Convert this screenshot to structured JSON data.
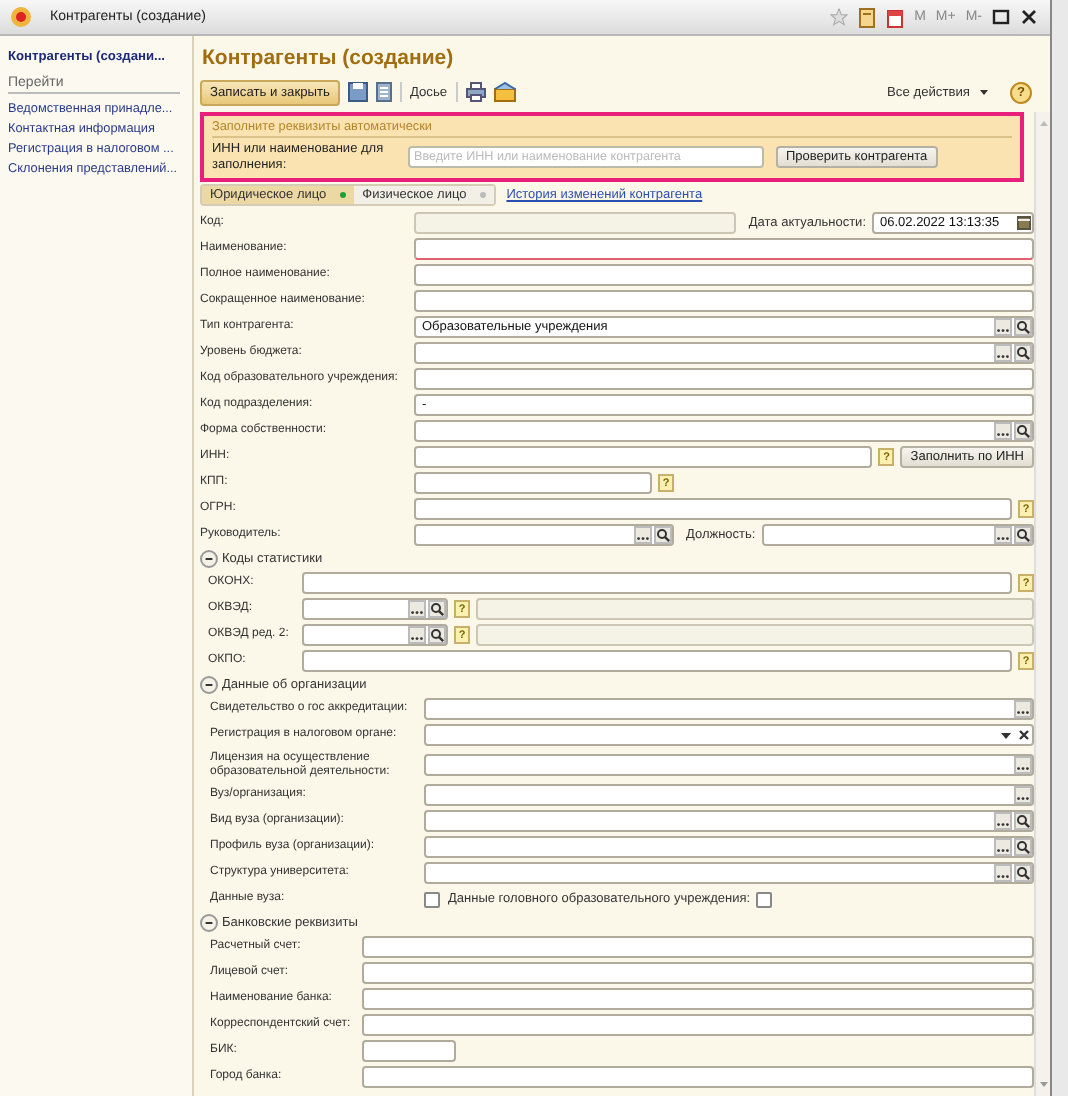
{
  "window": {
    "title": "Контрагенты (создание)",
    "memory_buttons": [
      "M",
      "M+",
      "M-"
    ]
  },
  "sidebar": {
    "title": "Контрагенты (создани...",
    "section": "Перейти",
    "items": [
      "Ведомственная принадле...",
      "Контактная информация",
      "Регистрация в налоговом ...",
      "Склонения представлений..."
    ]
  },
  "form": {
    "title": "Контрагенты (создание)",
    "save_close": "Записать и закрыть",
    "dossier": "Досье",
    "all_actions": "Все действия",
    "help": "?"
  },
  "autofill": {
    "heading": "Заполните реквизиты автоматически",
    "label": "ИНН или наименование для заполнения:",
    "placeholder": "Введите ИНН или наименование контрагента",
    "button": "Проверить контрагента"
  },
  "person_tabs": [
    {
      "label": "Юридическое лицо",
      "selected": true
    },
    {
      "label": "Физическое лицо",
      "selected": false
    }
  ],
  "history_link": "История изменений контрагента",
  "main_fields": [
    {
      "kind": "code_date",
      "label": "Код:",
      "date_label": "Дата актуальности:",
      "date_value": "06.02.2022 13:13:35"
    },
    {
      "kind": "text",
      "label": "Наименование:",
      "required": true
    },
    {
      "kind": "text",
      "label": "Полное наименование:"
    },
    {
      "kind": "text",
      "label": "Сокращенное наименование:"
    },
    {
      "kind": "choice",
      "label": "Тип контрагента:",
      "value": "Образовательные учреждения"
    },
    {
      "kind": "choice",
      "label": "Уровень бюджета:"
    },
    {
      "kind": "text",
      "label": "Код образовательного учреждения:"
    },
    {
      "kind": "text",
      "label": "Код подразделения:",
      "value": "-"
    },
    {
      "kind": "choice",
      "label": "Форма собственности:"
    },
    {
      "kind": "inn",
      "label": "ИНН:",
      "help": "?",
      "button": "Заполнить по ИНН"
    },
    {
      "kind": "short_text",
      "label": "КПП:",
      "help": "?"
    },
    {
      "kind": "text",
      "label": "ОГРН:",
      "help": "?"
    },
    {
      "kind": "pair",
      "label": "Руководитель:",
      "second_label": "Должность:"
    }
  ],
  "groups": [
    {
      "title": "Коды статистики",
      "expanded": true,
      "fields": [
        {
          "kind": "text",
          "label": "ОКОНХ:",
          "help": "?"
        },
        {
          "kind": "classifier",
          "label": "ОКВЭД:",
          "help": "?"
        },
        {
          "kind": "classifier",
          "label": "ОКВЭД ред. 2:",
          "help": "?"
        },
        {
          "kind": "text",
          "label": "ОКПО:",
          "help": "?"
        }
      ]
    },
    {
      "title": "Данные об организации",
      "expanded": true,
      "fields": [
        {
          "kind": "select",
          "label": "Свидетельство о гос аккредитации:"
        },
        {
          "kind": "dropdown",
          "label": "Регистрация в налоговом органе:"
        },
        {
          "kind": "select",
          "label": "Лицензия на осуществление образовательной деятельности:"
        },
        {
          "kind": "select",
          "label": "Вуз/организация:"
        },
        {
          "kind": "choice",
          "label": "Вид вуза (организации):"
        },
        {
          "kind": "choice",
          "label": "Профиль вуза (организации):"
        },
        {
          "kind": "choice",
          "label": "Структура университета:"
        },
        {
          "kind": "checks",
          "label": "Данные вуза:",
          "checked": false,
          "second_label": "Данные головного образовательного учреждения:",
          "second_checked": false
        }
      ]
    },
    {
      "title": "Банковские реквизиты",
      "expanded": true,
      "fields": [
        {
          "kind": "text",
          "label": "Расчетный счет:"
        },
        {
          "kind": "text",
          "label": "Лицевой счет:"
        },
        {
          "kind": "text",
          "label": "Наименование банка:"
        },
        {
          "kind": "text",
          "label": "Корреспондентский счет:"
        },
        {
          "kind": "short_text",
          "label": "БИК:"
        },
        {
          "kind": "text",
          "label": "Город банка:"
        }
      ]
    }
  ]
}
